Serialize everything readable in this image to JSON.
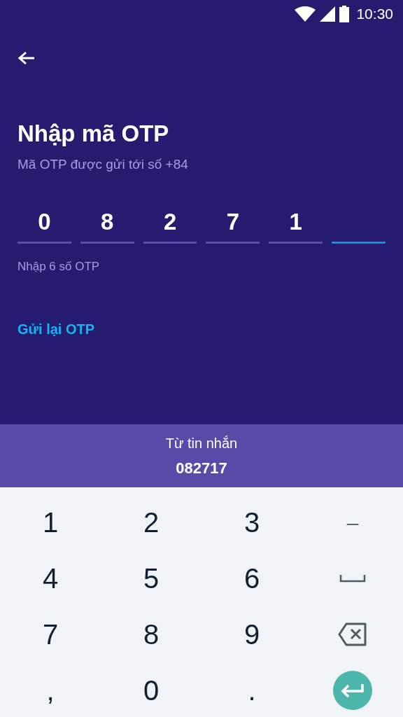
{
  "status_bar": {
    "time": "10:30"
  },
  "title": "Nhập mã OTP",
  "subtitle": "Mã OTP được gửi tới số +84",
  "otp_boxes": [
    {
      "value": "0",
      "selected": false
    },
    {
      "value": "8",
      "selected": false
    },
    {
      "value": "2",
      "selected": false
    },
    {
      "value": "7",
      "selected": false
    },
    {
      "value": "1",
      "selected": false
    },
    {
      "selected": true
    }
  ],
  "hint": "Nhập 6 số OTP",
  "resend_link": "Gửi lại OTP",
  "suggestion": {
    "label": "Từ tin nhắn",
    "code": "082717"
  },
  "keyboard": [
    {
      "kind": "text",
      "label": "1"
    },
    {
      "kind": "text",
      "label": "2"
    },
    {
      "kind": "text",
      "label": "3"
    },
    {
      "kind": "symbol",
      "label": "–"
    },
    {
      "kind": "text",
      "label": "4"
    },
    {
      "kind": "text",
      "label": "5"
    },
    {
      "kind": "text",
      "label": "6"
    },
    {
      "kind": "space"
    },
    {
      "kind": "text",
      "label": "7"
    },
    {
      "kind": "text",
      "label": "8"
    },
    {
      "kind": "text",
      "label": "9"
    },
    {
      "kind": "backspace"
    },
    {
      "kind": "text",
      "label": ","
    },
    {
      "kind": "text",
      "label": "0"
    },
    {
      "kind": "text",
      "label": "."
    },
    {
      "kind": "enter"
    }
  ]
}
